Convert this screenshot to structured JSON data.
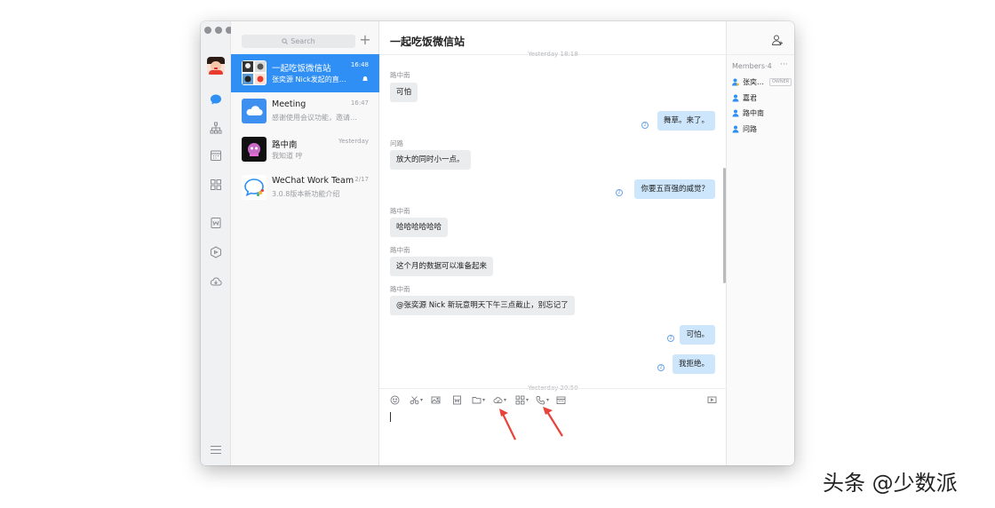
{
  "window": {
    "rail": {
      "items": [
        {
          "icon": "chat-icon",
          "active": true
        },
        {
          "icon": "org-chart-icon"
        },
        {
          "icon": "calendar-icon"
        },
        {
          "icon": "apps-grid-icon"
        },
        {
          "icon": "document-icon"
        },
        {
          "icon": "cube-icon"
        },
        {
          "icon": "cloud-drive-icon"
        }
      ],
      "menu_icon": "hamburger-icon"
    },
    "conversation_list": {
      "search_placeholder": "Search",
      "items": [
        {
          "name": "一起吃饭微信站",
          "time": "16:48",
          "preview": "张奕源 Nick发起的直…",
          "active": true,
          "muted": true
        },
        {
          "name": "Meeting",
          "time": "16:47",
          "preview": "感谢使用会议功能，邀请…"
        },
        {
          "name": "路中南",
          "time": "Yesterday",
          "preview": "我知道 哼"
        },
        {
          "name": "WeChat Work Team",
          "time": "2/17",
          "preview": "3.0.8版本新功能介绍"
        }
      ]
    },
    "chat": {
      "title": "一起吃饭微信站",
      "day_separator_top": "Yesterday 18:18",
      "day_separator_bottom": "Yesterday 20:50",
      "messages": [
        {
          "sender": "路中南",
          "text": "可怕",
          "dir": "in"
        },
        {
          "text": "舞草。来了。",
          "dir": "out",
          "read": "2"
        },
        {
          "sender": "问路",
          "text": "放大的同时小一点。",
          "dir": "in"
        },
        {
          "text": "你要五百强的威觉？",
          "dir": "out",
          "read": "2"
        },
        {
          "sender": "路中南",
          "text": "哈哈哈哈哈哈",
          "dir": "in"
        },
        {
          "sender": "路中南",
          "text": "这个月的数据可以准备起来",
          "dir": "in"
        },
        {
          "sender": "路中南",
          "text": "@张奕源 Nick 新玩意明天下午三点截止，别忘记了",
          "dir": "in"
        },
        {
          "text": "可怕。",
          "dir": "out",
          "read": "2"
        },
        {
          "text": "我拒绝。",
          "dir": "out",
          "read": "2"
        }
      ],
      "toolbar": {
        "tools": [
          "emoji-icon",
          "scissors-icon",
          "image-icon",
          "word-doc-icon",
          "folder-icon",
          "cloud-icon",
          "apps-icon",
          "phone-icon",
          "calendar-card-icon"
        ],
        "right_tool": "screen-share-icon"
      }
    },
    "members": {
      "label": "Members·4",
      "more": "···",
      "list": [
        {
          "name": "张奕…",
          "owner_badge": "OWNER"
        },
        {
          "name": "嘉君"
        },
        {
          "name": "路中南"
        },
        {
          "name": "问路"
        }
      ]
    },
    "colors": {
      "accent": "#2f8ff4",
      "outgoing_bubble": "#cde6fb",
      "incoming_bubble": "#ebecee",
      "annotation_arrow": "#e8423a"
    }
  },
  "watermark": "头条 @少数派"
}
